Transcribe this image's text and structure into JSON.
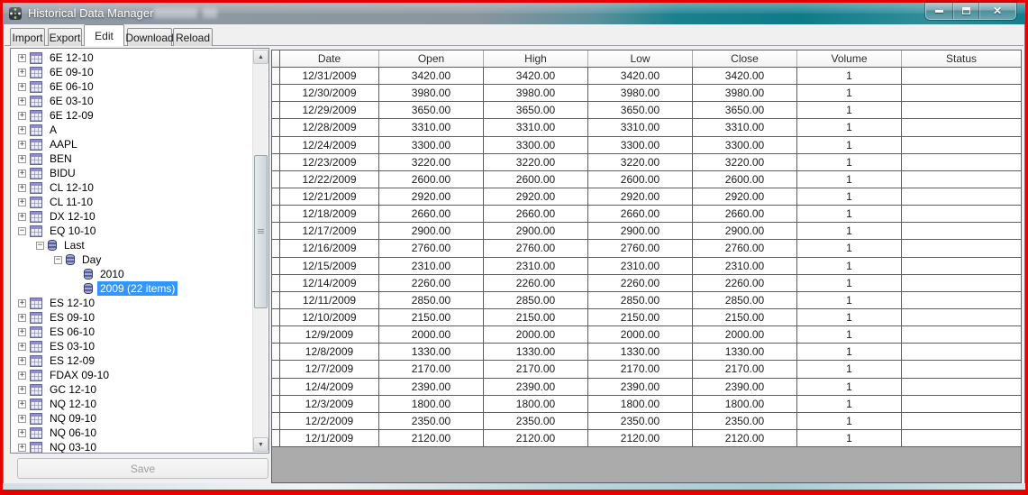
{
  "window": {
    "title": "Historical Data Manager",
    "controls": [
      {
        "name": "minimize"
      },
      {
        "name": "maximize"
      },
      {
        "name": "close"
      }
    ]
  },
  "tabs": [
    {
      "label": "Import",
      "active": false
    },
    {
      "label": "Export",
      "active": false
    },
    {
      "label": "Edit",
      "active": true
    },
    {
      "label": "Download",
      "active": false
    },
    {
      "label": "Reload",
      "active": false
    }
  ],
  "tree": {
    "items": [
      {
        "label": "6E 12-10",
        "level": 0,
        "expander": "+",
        "icon": "table",
        "selected": false
      },
      {
        "label": "6E 09-10",
        "level": 0,
        "expander": "+",
        "icon": "table",
        "selected": false
      },
      {
        "label": "6E 06-10",
        "level": 0,
        "expander": "+",
        "icon": "table",
        "selected": false
      },
      {
        "label": "6E 03-10",
        "level": 0,
        "expander": "+",
        "icon": "table",
        "selected": false
      },
      {
        "label": "6E 12-09",
        "level": 0,
        "expander": "+",
        "icon": "table",
        "selected": false
      },
      {
        "label": "A",
        "level": 0,
        "expander": "+",
        "icon": "table",
        "selected": false
      },
      {
        "label": "AAPL",
        "level": 0,
        "expander": "+",
        "icon": "table",
        "selected": false
      },
      {
        "label": "BEN",
        "level": 0,
        "expander": "+",
        "icon": "table",
        "selected": false
      },
      {
        "label": "BIDU",
        "level": 0,
        "expander": "+",
        "icon": "table",
        "selected": false
      },
      {
        "label": "CL 12-10",
        "level": 0,
        "expander": "+",
        "icon": "table",
        "selected": false
      },
      {
        "label": "CL 11-10",
        "level": 0,
        "expander": "+",
        "icon": "table",
        "selected": false
      },
      {
        "label": "DX 12-10",
        "level": 0,
        "expander": "+",
        "icon": "table",
        "selected": false
      },
      {
        "label": "EQ 10-10",
        "level": 0,
        "expander": "−",
        "icon": "table",
        "selected": false
      },
      {
        "label": "Last",
        "level": 1,
        "expander": "−",
        "icon": "db",
        "selected": false
      },
      {
        "label": "Day",
        "level": 2,
        "expander": "−",
        "icon": "db",
        "selected": false
      },
      {
        "label": "2010",
        "level": 3,
        "expander": "",
        "icon": "db",
        "selected": false
      },
      {
        "label": "2009 (22 items)",
        "level": 3,
        "expander": "",
        "icon": "db",
        "selected": true
      },
      {
        "label": "ES 12-10",
        "level": 0,
        "expander": "+",
        "icon": "table",
        "selected": false
      },
      {
        "label": "ES 09-10",
        "level": 0,
        "expander": "+",
        "icon": "table",
        "selected": false
      },
      {
        "label": "ES 06-10",
        "level": 0,
        "expander": "+",
        "icon": "table",
        "selected": false
      },
      {
        "label": "ES 03-10",
        "level": 0,
        "expander": "+",
        "icon": "table",
        "selected": false
      },
      {
        "label": "ES 12-09",
        "level": 0,
        "expander": "+",
        "icon": "table",
        "selected": false
      },
      {
        "label": "FDAX 09-10",
        "level": 0,
        "expander": "+",
        "icon": "table",
        "selected": false
      },
      {
        "label": "GC 12-10",
        "level": 0,
        "expander": "+",
        "icon": "table",
        "selected": false
      },
      {
        "label": "NQ 12-10",
        "level": 0,
        "expander": "+",
        "icon": "table",
        "selected": false
      },
      {
        "label": "NQ 09-10",
        "level": 0,
        "expander": "+",
        "icon": "table",
        "selected": false
      },
      {
        "label": "NQ 06-10",
        "level": 0,
        "expander": "+",
        "icon": "table",
        "selected": false
      },
      {
        "label": "NQ 03-10",
        "level": 0,
        "expander": "+",
        "icon": "table",
        "selected": false
      }
    ]
  },
  "save_button": {
    "label": "Save",
    "enabled": false
  },
  "grid": {
    "columns": [
      "Date",
      "Open",
      "High",
      "Low",
      "Close",
      "Volume",
      "Status"
    ],
    "rows": [
      [
        "12/31/2009",
        "3420.00",
        "3420.00",
        "3420.00",
        "3420.00",
        "1",
        ""
      ],
      [
        "12/30/2009",
        "3980.00",
        "3980.00",
        "3980.00",
        "3980.00",
        "1",
        ""
      ],
      [
        "12/29/2009",
        "3650.00",
        "3650.00",
        "3650.00",
        "3650.00",
        "1",
        ""
      ],
      [
        "12/28/2009",
        "3310.00",
        "3310.00",
        "3310.00",
        "3310.00",
        "1",
        ""
      ],
      [
        "12/24/2009",
        "3300.00",
        "3300.00",
        "3300.00",
        "3300.00",
        "1",
        ""
      ],
      [
        "12/23/2009",
        "3220.00",
        "3220.00",
        "3220.00",
        "3220.00",
        "1",
        ""
      ],
      [
        "12/22/2009",
        "2600.00",
        "2600.00",
        "2600.00",
        "2600.00",
        "1",
        ""
      ],
      [
        "12/21/2009",
        "2920.00",
        "2920.00",
        "2920.00",
        "2920.00",
        "1",
        ""
      ],
      [
        "12/18/2009",
        "2660.00",
        "2660.00",
        "2660.00",
        "2660.00",
        "1",
        ""
      ],
      [
        "12/17/2009",
        "2900.00",
        "2900.00",
        "2900.00",
        "2900.00",
        "1",
        ""
      ],
      [
        "12/16/2009",
        "2760.00",
        "2760.00",
        "2760.00",
        "2760.00",
        "1",
        ""
      ],
      [
        "12/15/2009",
        "2310.00",
        "2310.00",
        "2310.00",
        "2310.00",
        "1",
        ""
      ],
      [
        "12/14/2009",
        "2260.00",
        "2260.00",
        "2260.00",
        "2260.00",
        "1",
        ""
      ],
      [
        "12/11/2009",
        "2850.00",
        "2850.00",
        "2850.00",
        "2850.00",
        "1",
        ""
      ],
      [
        "12/10/2009",
        "2150.00",
        "2150.00",
        "2150.00",
        "2150.00",
        "1",
        ""
      ],
      [
        "12/9/2009",
        "2000.00",
        "2000.00",
        "2000.00",
        "2000.00",
        "1",
        ""
      ],
      [
        "12/8/2009",
        "1330.00",
        "1330.00",
        "1330.00",
        "1330.00",
        "1",
        ""
      ],
      [
        "12/7/2009",
        "2170.00",
        "2170.00",
        "2170.00",
        "2170.00",
        "1",
        ""
      ],
      [
        "12/4/2009",
        "2390.00",
        "2390.00",
        "2390.00",
        "2390.00",
        "1",
        ""
      ],
      [
        "12/3/2009",
        "1800.00",
        "1800.00",
        "1800.00",
        "1800.00",
        "1",
        ""
      ],
      [
        "12/2/2009",
        "2350.00",
        "2350.00",
        "2350.00",
        "2350.00",
        "1",
        ""
      ],
      [
        "12/1/2009",
        "2120.00",
        "2120.00",
        "2120.00",
        "2120.00",
        "1",
        ""
      ]
    ]
  },
  "icons": {
    "scroll_up": "▲",
    "scroll_down": "▼",
    "close_glyph": "✕"
  },
  "colors": {
    "annotation_border": "#e60000",
    "titlebar_teal": "#0e7b8a",
    "titlebar_grey": "#8f99a3",
    "selection_blue": "#3297fd",
    "grid_empty_bg": "#ababab",
    "content_bg": "#f0f0f0"
  }
}
